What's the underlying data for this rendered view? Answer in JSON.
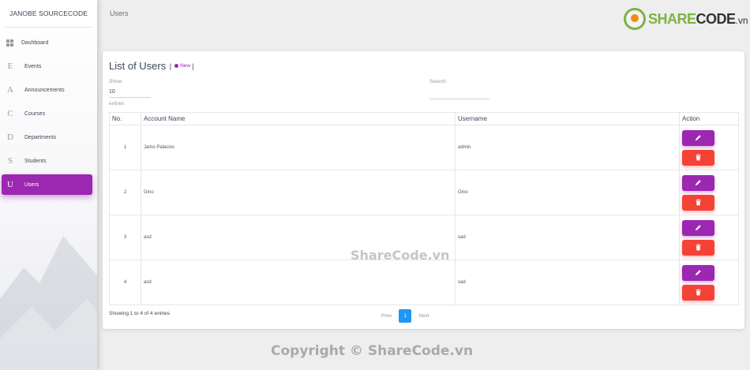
{
  "sidebar": {
    "brand": "JANOBE SOURCECODE",
    "items": [
      {
        "icon": "D",
        "label": "Dashboard"
      },
      {
        "icon": "E",
        "label": "Events"
      },
      {
        "icon": "A",
        "label": "Announcements"
      },
      {
        "icon": "C",
        "label": "Courses"
      },
      {
        "icon": "D",
        "label": "Departments"
      },
      {
        "icon": "S",
        "label": "Students"
      },
      {
        "icon": "U",
        "label": "Users"
      }
    ],
    "active": "Users"
  },
  "header": {
    "title": "Users"
  },
  "logo": {
    "share": "SHARE",
    "code": "CODE",
    "tld": ".vn"
  },
  "card": {
    "title": "List of Users",
    "new_label": "New",
    "show_label": "Show",
    "show_value": "10",
    "entries_label": "entries",
    "search_label": "Search:",
    "search_value": ""
  },
  "table": {
    "columns": [
      "No.",
      "Account Name",
      "Username",
      "Action"
    ],
    "rows": [
      {
        "no": "1",
        "account_name": "Jamo Palacios",
        "username": "admin"
      },
      {
        "no": "2",
        "account_name": "Gino",
        "username": "Gino"
      },
      {
        "no": "3",
        "account_name": "asd",
        "username": "sad"
      },
      {
        "no": "4",
        "account_name": "asd",
        "username": "sad"
      }
    ]
  },
  "footer": {
    "info": "Showing 1 to 4 of 4 entries",
    "prev": "Prev",
    "page": "1",
    "next": "Next"
  },
  "watermarks": {
    "center": "ShareCode.vn",
    "bottom": "Copyright © ShareCode.vn"
  },
  "colors": {
    "accent": "#9c27b0",
    "danger": "#f44336",
    "pager_active": "#2196f3"
  }
}
